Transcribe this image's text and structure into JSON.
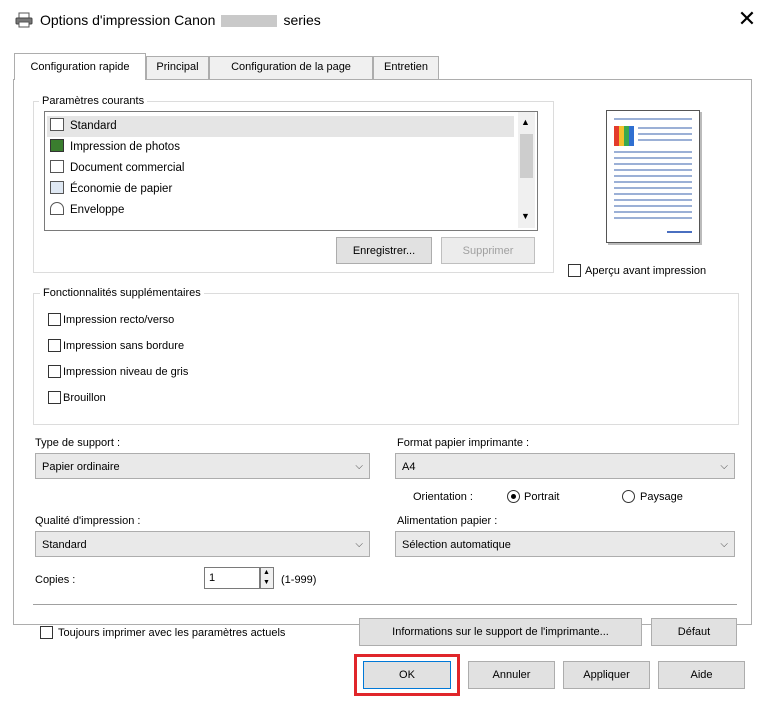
{
  "window": {
    "title_left": "Options d'impression Canon",
    "title_right": "series",
    "close": "✕"
  },
  "tabs": [
    {
      "label": "Configuration rapide",
      "active": true
    },
    {
      "label": "Principal",
      "active": false
    },
    {
      "label": "Configuration de la page",
      "active": false
    },
    {
      "label": "Entretien",
      "active": false
    }
  ],
  "current_settings": {
    "legend": "Paramètres courants",
    "items": [
      {
        "label": "Standard",
        "icon": "standard-preset-icon",
        "selected": true
      },
      {
        "label": "Impression de photos",
        "icon": "photo-preset-icon",
        "selected": false
      },
      {
        "label": "Document commercial",
        "icon": "document-preset-icon",
        "selected": false
      },
      {
        "label": "Économie de papier",
        "icon": "paper-saving-preset-icon",
        "selected": false
      },
      {
        "label": "Enveloppe",
        "icon": "envelope-preset-icon",
        "selected": false
      }
    ],
    "save_button": "Enregistrer...",
    "delete_button": "Supprimer"
  },
  "preview": {
    "checkbox_label": "Aperçu avant impression",
    "checked": false
  },
  "additional_features": {
    "legend": "Fonctionnalités supplémentaires",
    "items": [
      {
        "label": "Impression recto/verso",
        "checked": false
      },
      {
        "label": "Impression sans bordure",
        "checked": false
      },
      {
        "label": "Impression niveau de gris",
        "checked": false
      },
      {
        "label": "Brouillon",
        "checked": false
      }
    ]
  },
  "media_type": {
    "label": "Type de support :",
    "value": "Papier ordinaire"
  },
  "paper_size": {
    "label": "Format papier imprimante :",
    "value": "A4"
  },
  "orientation": {
    "label": "Orientation :",
    "options": [
      {
        "label": "Portrait",
        "selected": true
      },
      {
        "label": "Paysage",
        "selected": false
      }
    ]
  },
  "print_quality": {
    "label": "Qualité d'impression :",
    "value": "Standard"
  },
  "paper_source": {
    "label": "Alimentation papier :",
    "value": "Sélection automatique"
  },
  "copies": {
    "label": "Copies :",
    "value": "1",
    "range": "(1-999)"
  },
  "always_print": {
    "label": "Toujours imprimer avec les paramètres actuels",
    "checked": false
  },
  "media_info_button": "Informations sur le support de l'imprimante...",
  "default_button": "Défaut",
  "footer": {
    "ok": "OK",
    "cancel": "Annuler",
    "apply": "Appliquer",
    "help": "Aide"
  },
  "colors": {
    "highlight": "#e0262a",
    "dialog_bg": "#f0f0f0",
    "selection": "#e5e5e5"
  }
}
